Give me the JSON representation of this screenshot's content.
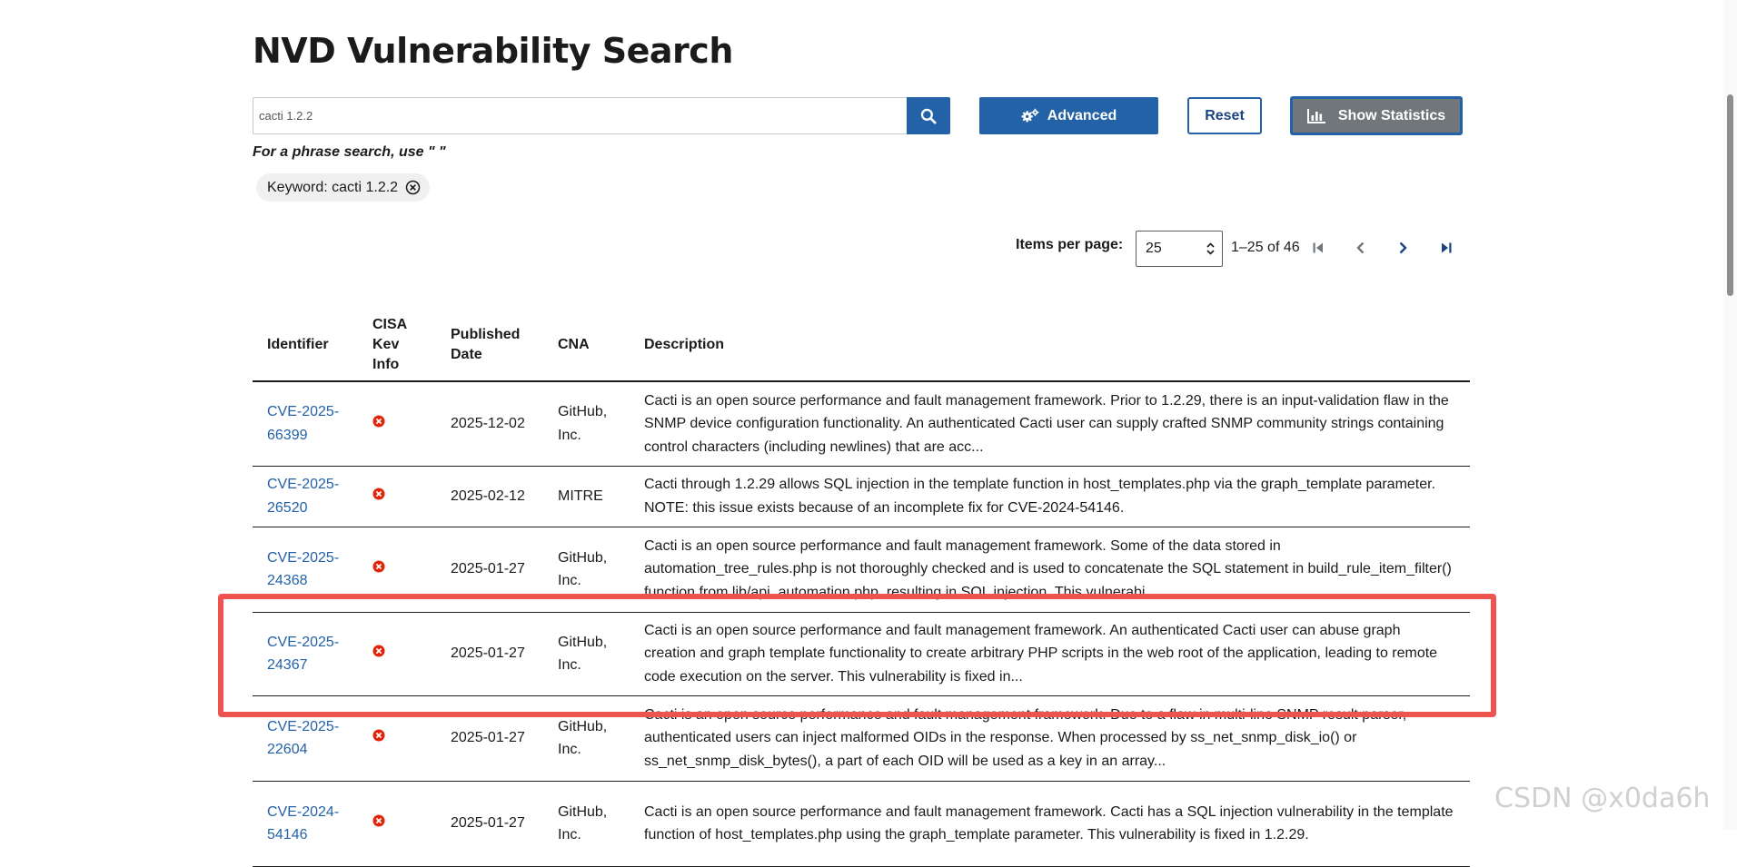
{
  "header": {
    "title": "NVD Vulnerability Search"
  },
  "search": {
    "value": "cacti 1.2.2",
    "hint": "For a phrase search, use \" \""
  },
  "toolbar": {
    "advanced_label": "Advanced",
    "reset_label": "Reset",
    "stats_label": "Show Statistics"
  },
  "filters": {
    "keyword_chip": "Keyword: cacti 1.2.2"
  },
  "pagination": {
    "items_label": "Items per page:",
    "items_value": "25",
    "range": "1–25 of 46"
  },
  "table": {
    "headers": {
      "identifier": "Identifier",
      "kev": [
        "CISA",
        "Kev",
        "Info"
      ],
      "published": [
        "Published",
        "Date"
      ],
      "cna": "CNA",
      "description": "Description"
    },
    "rows": [
      {
        "id_a": "CVE-2025-",
        "id_b": "66399",
        "date": "2025-12-02",
        "cna_a": "GitHub,",
        "cna_b": "Inc.",
        "description": "Cacti is an open source performance and fault management framework. Prior to 1.2.29, there is an input-validation flaw in the SNMP device configuration functionality. An authenticated Cacti user can supply crafted SNMP community strings containing control characters (including newlines) that are acc..."
      },
      {
        "id_a": "CVE-2025-",
        "id_b": "26520",
        "date": "2025-02-12",
        "cna_a": "MITRE",
        "cna_b": "",
        "description": "Cacti through 1.2.29 allows SQL injection in the template function in host_templates.php via the graph_template parameter. NOTE: this issue exists because of an incomplete fix for CVE-2024-54146."
      },
      {
        "id_a": "CVE-2025-",
        "id_b": "24368",
        "date": "2025-01-27",
        "cna_a": "GitHub,",
        "cna_b": "Inc.",
        "description": "Cacti is an open source performance and fault management framework. Some of the data stored in automation_tree_rules.php is not thoroughly checked and is used to concatenate the SQL statement in build_rule_item_filter() function from lib/api_automation.php, resulting in SQL injection. This vulnerabi..."
      },
      {
        "id_a": "CVE-2025-",
        "id_b": "24367",
        "date": "2025-01-27",
        "cna_a": "GitHub,",
        "cna_b": "Inc.",
        "description": "Cacti is an open source performance and fault management framework. An authenticated Cacti user can abuse graph creation and graph template functionality to create arbitrary PHP scripts in the web root of the application, leading to remote code execution on the server. This vulnerability is fixed in..."
      },
      {
        "id_a": "CVE-2025-",
        "id_b": "22604",
        "date": "2025-01-27",
        "cna_a": "GitHub,",
        "cna_b": "Inc.",
        "description": "Cacti is an open source performance and fault management framework. Due to a flaw in multi-line SNMP result parser, authenticated users can inject malformed OIDs in the response. When processed by ss_net_snmp_disk_io() or ss_net_snmp_disk_bytes(), a part of each OID will be used as a key in an array..."
      },
      {
        "id_a": "CVE-2024-",
        "id_b": "54146",
        "date": "2025-01-27",
        "cna_a": "GitHub,",
        "cna_b": "Inc.",
        "description": "Cacti is an open source performance and fault management framework. Cacti has a SQL injection vulnerability in the template function of host_templates.php using the graph_template parameter. This vulnerability is fixed in 1.2.29."
      }
    ]
  },
  "watermark": "CSDN @x0da6h",
  "colors": {
    "primary": "#2462a8",
    "highlight": "#ef5350",
    "kev_icon": "#e52207",
    "stats_bg": "#71767a"
  },
  "icons": [
    "search-icon",
    "gears-icon",
    "bar-chart-icon",
    "close-circle-icon",
    "first-page-icon",
    "prev-page-icon",
    "next-page-icon",
    "last-page-icon",
    "not-kev-icon"
  ]
}
